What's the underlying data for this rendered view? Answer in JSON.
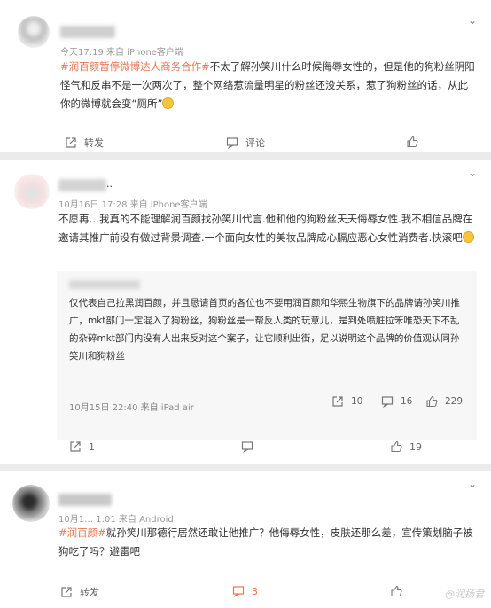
{
  "comments": [
    {
      "meta": "今天17:19  来自 iPhone客户端",
      "hashtag": "#润百颜暂停微博达人商务合作#",
      "text": "不太了解孙笑川什么时候侮辱女性的，但是他的狗粉丝阴阳怪气和反串不是一次两次了，整个网络惹流量明星的粉丝还没关系，惹了狗粉丝的话，从此你的微博就会变“厕所”",
      "actions": {
        "repost": "转发",
        "comment": "评论",
        "like": ""
      }
    },
    {
      "name_suffix": "..",
      "meta": "10月16日 17:28  来自 iPhone客户端",
      "text": "不愿再…我真的不能理解润百颜找孙笑川代言.他和他的狗粉丝天天侮辱女性.我不相信品牌在邀请其推广前没有做过背景调查.一个面向女性的美妆品牌成心膈应恶心女性消费者.快滚吧",
      "retweet": {
        "text": "仅代表自己拉黑润百颜，并且恳请首页的各位也不要用润百颜和华熙生物旗下的品牌请孙笑川推广，mkt部门一定混入了狗粉丝，狗粉丝是一帮反人类的玩意儿，是到处喷脏拉笨唯恐天下不乱的杂碎mkt部门内没有人出来反对这个案子，让它顺利出街，足以说明这个品牌的价值观认同孙笑川和狗粉丝",
        "meta": "10月15日 22:40  来自 iPad air",
        "repost": "10",
        "comment": "16",
        "like": "229"
      },
      "actions": {
        "repost": "1",
        "comment": "",
        "like": "19"
      }
    },
    {
      "meta": "10月1… 1:01  来自 Android",
      "hashtag": "#润百颜#",
      "text": "就孙笑川那德行居然还敢让他推广？他侮辱女性，皮肤还那么差，宣传策划脑子被狗吃了吗？避雷吧",
      "actions": {
        "repost": "转发",
        "comment": "3",
        "like": ""
      }
    }
  ],
  "watermark": "@润扬君",
  "colors": {
    "accent": "#eb7350",
    "meta": "#999999",
    "card_bg": "#ffffff",
    "page_bg": "#ebebeb",
    "retweet_bg": "#f7f7f7"
  }
}
